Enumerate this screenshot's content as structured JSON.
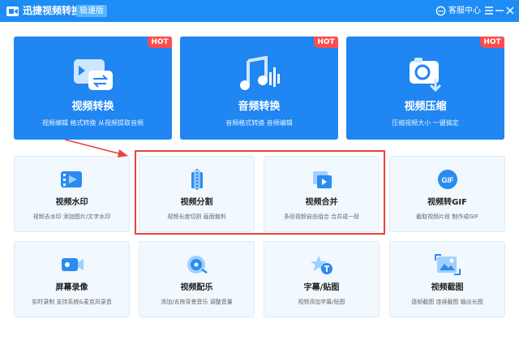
{
  "window": {
    "title": "迅捷视频转换器",
    "badge": "极速版",
    "help_label": "客服中心"
  },
  "colors": {
    "titlebar": "#1e8cf5",
    "card": "#1f86f2",
    "hot": "#ff4d4d",
    "highlight": "#e8433d"
  },
  "big_cards": [
    {
      "title": "视频转换",
      "desc": "视频编辑 格式转换 从视频提取音频",
      "hot": "HOT",
      "icon": "video-convert-icon"
    },
    {
      "title": "音频转换",
      "desc": "音频格式转换 音频编辑",
      "hot": "HOT",
      "icon": "audio-convert-icon"
    },
    {
      "title": "视频压缩",
      "desc": "压缩视频大小 一键搞定",
      "hot": "HOT",
      "icon": "video-compress-icon"
    }
  ],
  "small_cards": [
    {
      "title": "视频水印",
      "desc": "视频去水印 添加图片/文字水印",
      "icon": "video-watermark-icon"
    },
    {
      "title": "视频分割",
      "desc": "视频长度切割 画面裁剪",
      "icon": "video-split-icon"
    },
    {
      "title": "视频合并",
      "desc": "多段视频自由组合 合并成一段",
      "icon": "video-merge-icon"
    },
    {
      "title": "视频转GIF",
      "desc": "截取视频片段 制作成GIF",
      "icon": "video-gif-icon",
      "icon_text": "GIF"
    },
    {
      "title": "屏幕录像",
      "desc": "实时录制 支持系统&麦克风录音",
      "icon": "screen-record-icon"
    },
    {
      "title": "视频配乐",
      "desc": "添加/去除背景音乐 调整音量",
      "icon": "video-music-icon"
    },
    {
      "title": "字幕/贴图",
      "desc": "视频添加字幕/贴图",
      "icon": "subtitle-sticker-icon"
    },
    {
      "title": "视频截图",
      "desc": "逐帧截图 连续截图 输出长图",
      "icon": "video-screenshot-icon"
    }
  ]
}
